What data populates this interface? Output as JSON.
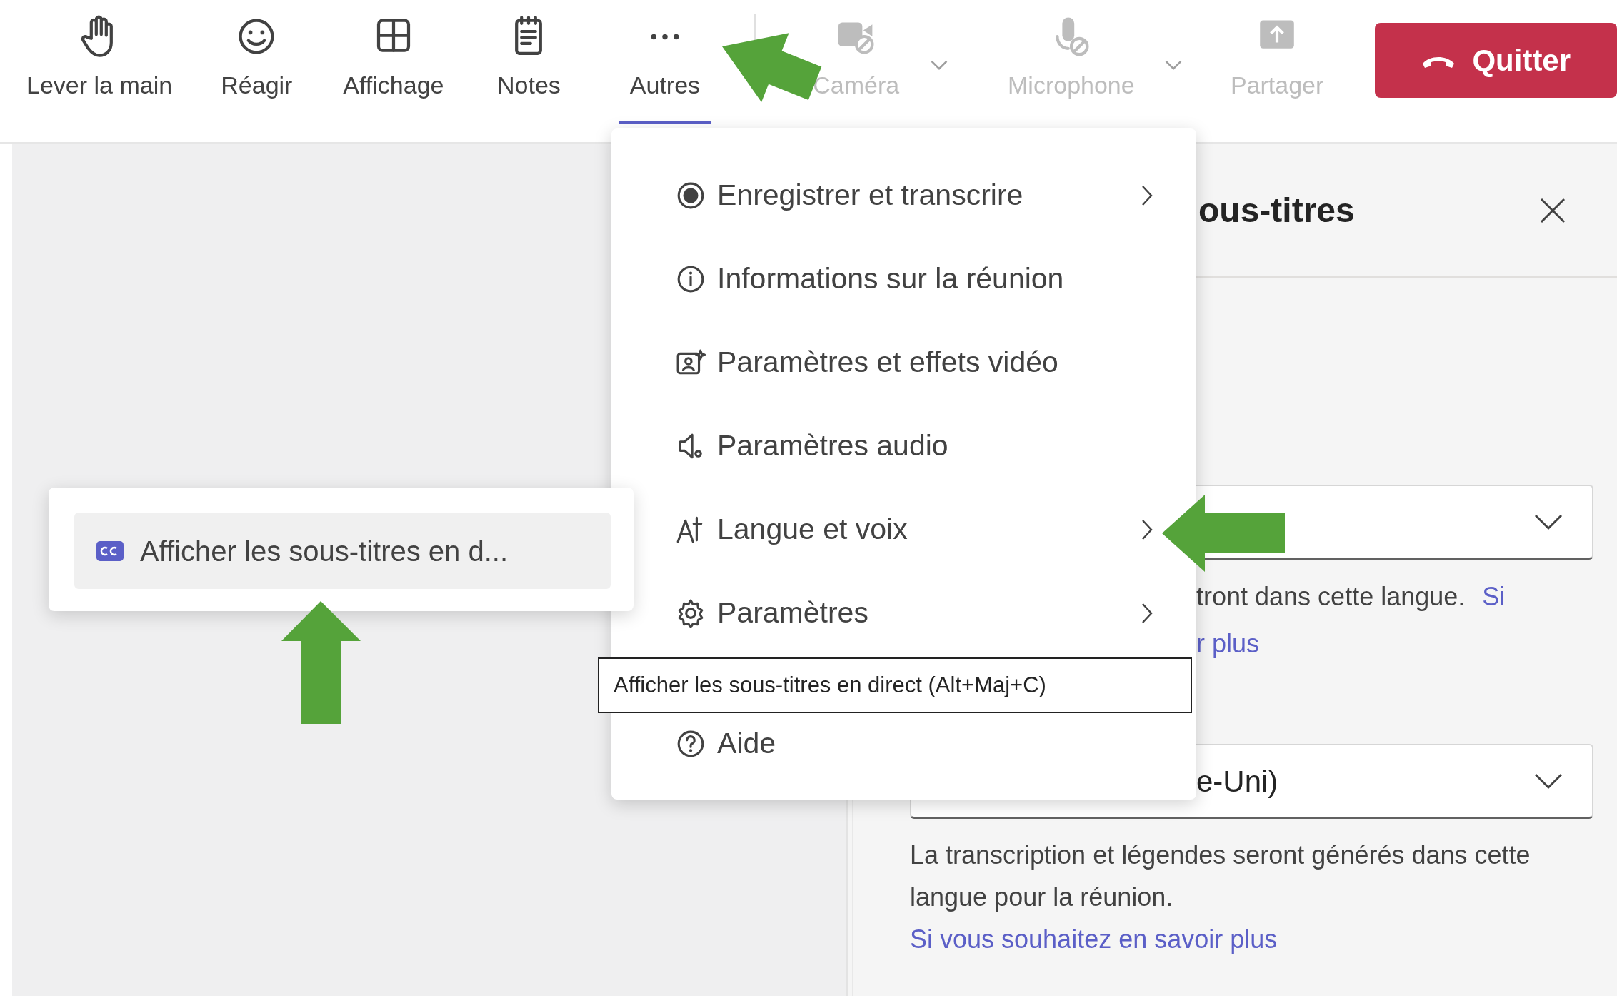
{
  "toolbar": {
    "items": [
      {
        "label": "Lever la main",
        "selected": false,
        "disabled": false,
        "has_menu": false
      },
      {
        "label": "Réagir",
        "selected": false,
        "disabled": false,
        "has_menu": false
      },
      {
        "label": "Affichage",
        "selected": false,
        "disabled": false,
        "has_menu": false
      },
      {
        "label": "Notes",
        "selected": false,
        "disabled": false,
        "has_menu": false
      },
      {
        "label": "Autres",
        "selected": true,
        "disabled": false,
        "has_menu": false
      },
      {
        "label": "Caméra",
        "selected": false,
        "disabled": true,
        "has_menu": true
      },
      {
        "label": "Microphone",
        "selected": false,
        "disabled": true,
        "has_menu": true
      },
      {
        "label": "Partager",
        "selected": false,
        "disabled": true,
        "has_menu": false
      }
    ],
    "leave_button": {
      "label": "Quitter"
    }
  },
  "side_panel": {
    "title": "ous-titres",
    "dropdowns": [
      {
        "hint_lines": [
          {
            "text": "tront dans cette langue.",
            "link": "Si"
          },
          {
            "link": "r plus"
          }
        ]
      },
      {
        "value": "e-Uni)",
        "description": "La transcription et légendes seront générés dans cette langue pour la réunion.",
        "link": "Si vous souhaitez en savoir plus"
      }
    ]
  },
  "more_menu": {
    "items": [
      {
        "label": "Enregistrer et transcrire",
        "has_submenu": true
      },
      {
        "label": "Informations sur la réunion",
        "has_submenu": false
      },
      {
        "label": "Paramètres et effets vidéo",
        "has_submenu": false
      },
      {
        "label": "Paramètres audio",
        "has_submenu": false
      },
      {
        "label": "Langue et voix",
        "has_submenu": true
      },
      {
        "label": "Paramètres",
        "has_submenu": true
      },
      {
        "label": "Aide",
        "has_submenu": false
      }
    ]
  },
  "submenu": {
    "items": [
      {
        "label": "Afficher les sous-titres en d...",
        "highlighted": true
      }
    ]
  },
  "tooltip": {
    "text": "Afficher les sous-titres en direct (Alt+Maj+C)"
  }
}
